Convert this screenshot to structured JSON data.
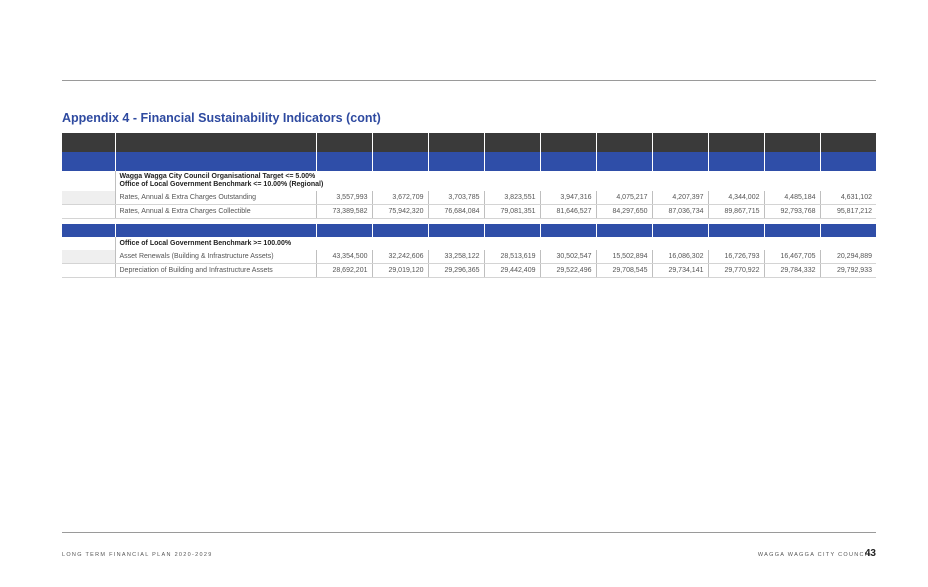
{
  "heading": "Appendix 4 - Financial Sustainability Indicators (cont)",
  "section1": {
    "benchmarks": [
      "Wagga Wagga City Council Organisational Target <= 5.00%",
      "Office of Local Government Benchmark <= 10.00% (Regional)"
    ],
    "rows": [
      {
        "label": "Rates, Annual & Extra Charges Outstanding",
        "values": [
          "3,557,993",
          "3,672,709",
          "3,703,785",
          "3,823,551",
          "3,947,316",
          "4,075,217",
          "4,207,397",
          "4,344,002",
          "4,485,184",
          "4,631,102"
        ]
      },
      {
        "label": "Rates, Annual & Extra Charges Collectible",
        "values": [
          "73,389,582",
          "75,942,320",
          "76,684,084",
          "79,081,351",
          "81,646,527",
          "84,297,650",
          "87,036,734",
          "89,867,715",
          "92,793,768",
          "95,817,212"
        ]
      }
    ]
  },
  "section2": {
    "benchmarks": [
      "Office of Local Government Benchmark >= 100.00%"
    ],
    "rows": [
      {
        "label": "Asset Renewals (Building & Infrastructure Assets)",
        "values": [
          "43,354,500",
          "32,242,606",
          "33,258,122",
          "28,513,619",
          "30,502,547",
          "15,502,894",
          "16,086,302",
          "16,726,793",
          "16,467,705",
          "20,294,889"
        ]
      },
      {
        "label": "Depreciation of Building and Infrastructure Assets",
        "values": [
          "28,692,201",
          "29,019,120",
          "29,296,365",
          "29,442,409",
          "29,522,496",
          "29,708,545",
          "29,734,141",
          "29,770,922",
          "29,784,332",
          "29,792,933"
        ]
      }
    ]
  },
  "footer": {
    "left": "LONG TERM FINANCIAL PLAN 2020-2029",
    "right": "WAGGA WAGGA CITY COUNCIL",
    "page": "43"
  }
}
